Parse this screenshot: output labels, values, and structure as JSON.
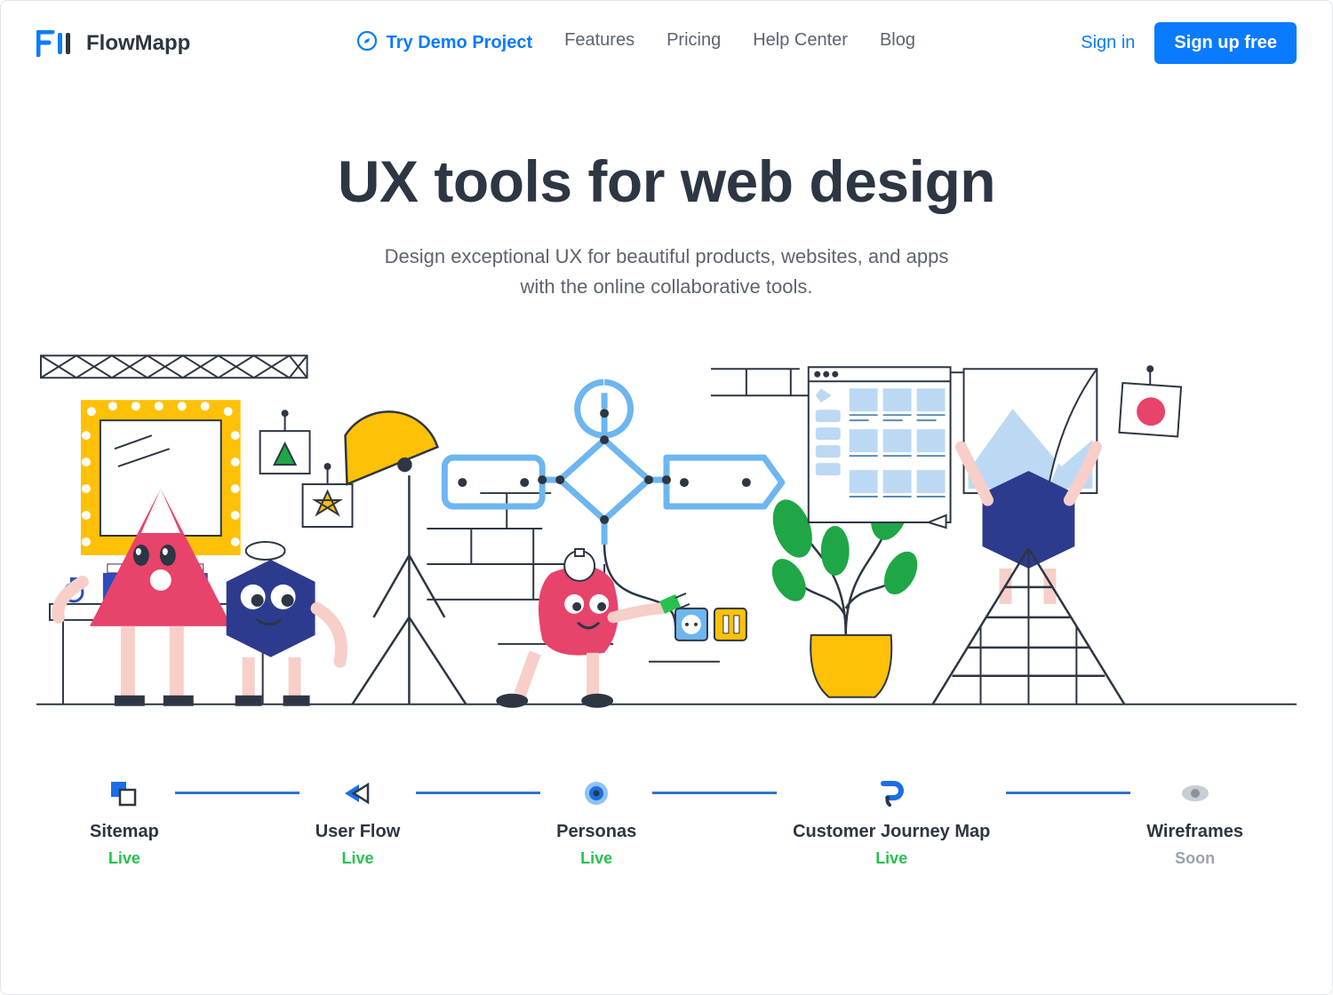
{
  "brand": "FlowMapp",
  "nav": {
    "demo": "Try Demo Project",
    "features": "Features",
    "pricing": "Pricing",
    "help": "Help Center",
    "blog": "Blog"
  },
  "auth": {
    "signin": "Sign in",
    "signup": "Sign up free"
  },
  "hero": {
    "title": "UX tools for web design",
    "sub1": "Design exceptional UX for beautiful products, websites, and apps",
    "sub2": "with the online collaborative tools."
  },
  "features": [
    {
      "title": "Sitemap",
      "status": "Live",
      "status_class": "live"
    },
    {
      "title": "User Flow",
      "status": "Live",
      "status_class": "live"
    },
    {
      "title": "Personas",
      "status": "Live",
      "status_class": "live"
    },
    {
      "title": "Customer Journey Map",
      "status": "Live",
      "status_class": "live"
    },
    {
      "title": "Wireframes",
      "status": "Soon",
      "status_class": "soon"
    }
  ],
  "colors": {
    "accent": "#0a7bff",
    "yellow": "#ffc107",
    "pink": "#e8436a",
    "green": "#27c24c",
    "navy": "#2d3b8f"
  }
}
